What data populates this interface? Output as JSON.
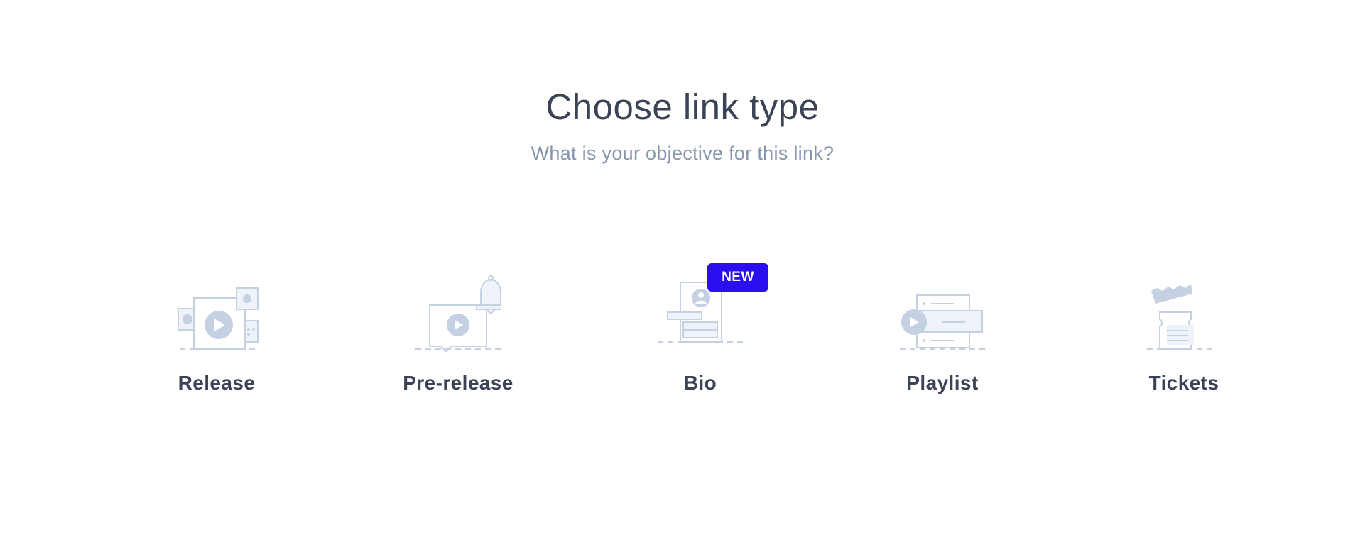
{
  "header": {
    "title": "Choose link type",
    "subtitle": "What is your objective for this link?"
  },
  "link_types": [
    {
      "label": "Release",
      "icon": "release-icon"
    },
    {
      "label": "Pre-release",
      "icon": "pre-release-icon"
    },
    {
      "label": "Bio",
      "icon": "bio-icon",
      "badge": "NEW"
    },
    {
      "label": "Playlist",
      "icon": "playlist-icon"
    },
    {
      "label": "Tickets",
      "icon": "tickets-icon"
    }
  ],
  "colors": {
    "heading": "#3b4357",
    "subtitle": "#8796ad",
    "illustration_stroke": "#c6d0e3",
    "illustration_fill": "#eef2f9",
    "badge": "#2b0ff0"
  }
}
